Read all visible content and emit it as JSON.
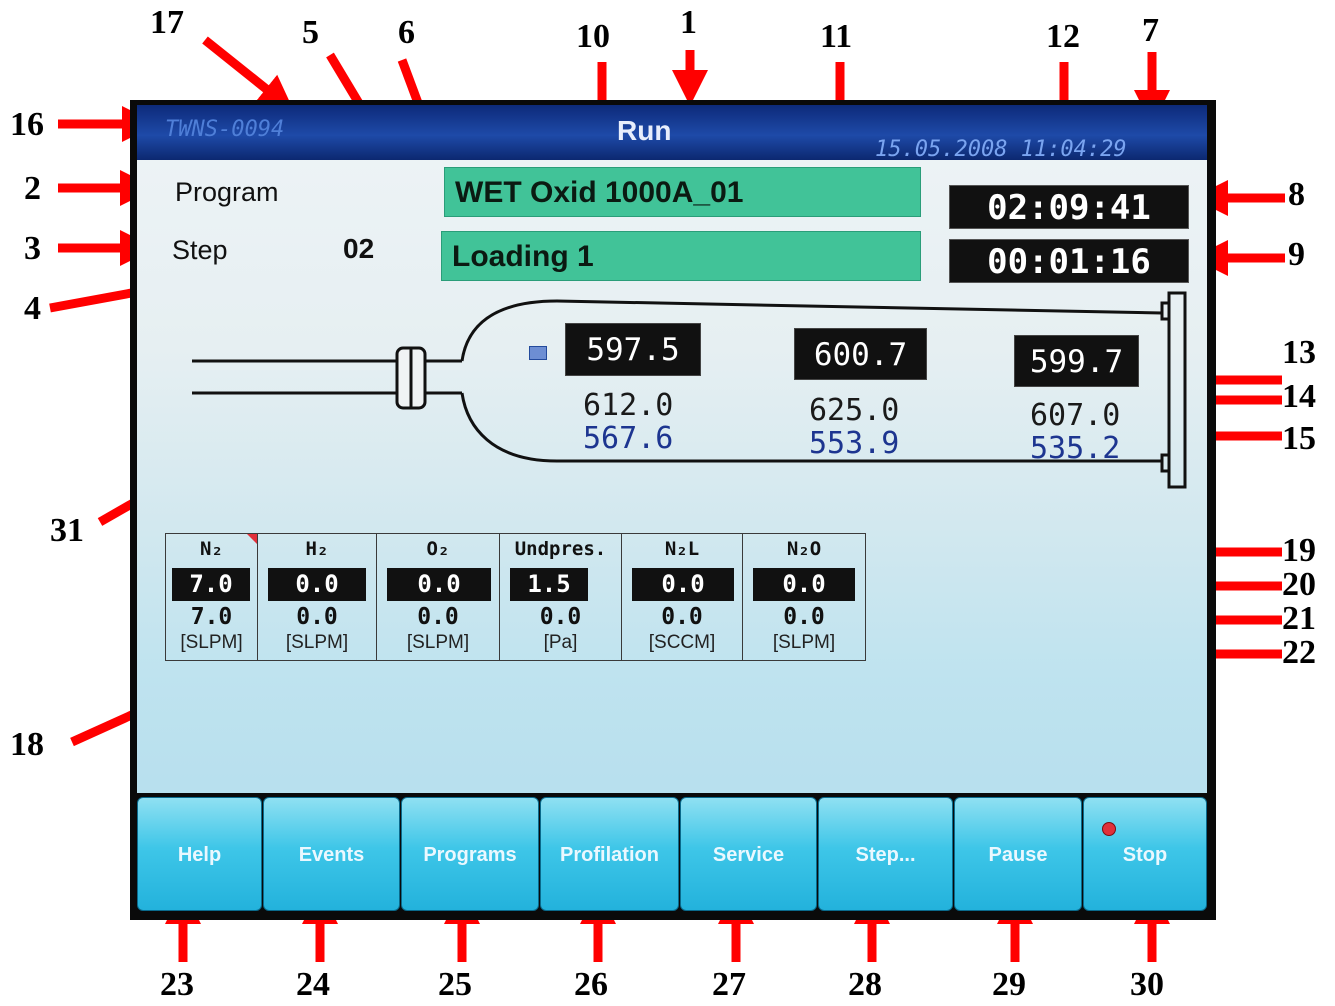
{
  "titlebar": {
    "system_id": "TWNS-0094",
    "title": "Run",
    "datetime": "15.05.2008 11:04:29"
  },
  "program": {
    "label": "Program",
    "name": "WET Oxid 1000A_01"
  },
  "step": {
    "label": "Step",
    "number": "02",
    "name": "Loading 1"
  },
  "timers": {
    "total": "02:09:41",
    "step": "00:01:16"
  },
  "zones": [
    {
      "actual": "597.5",
      "setpoint": "612.0",
      "lower": "567.6"
    },
    {
      "actual": "600.7",
      "setpoint": "625.0",
      "lower": "553.9"
    },
    {
      "actual": "599.7",
      "setpoint": "607.0",
      "lower": "535.2"
    }
  ],
  "gases": [
    {
      "name": "N₂",
      "value": "7.0",
      "setpoint": "7.0",
      "unit": "[SLPM]"
    },
    {
      "name": "H₂",
      "value": "0.0",
      "setpoint": "0.0",
      "unit": "[SLPM]"
    },
    {
      "name": "O₂",
      "value": "0.0",
      "setpoint": "0.0",
      "unit": "[SLPM]"
    },
    {
      "name": "Undpres.",
      "value": "1.5",
      "setpoint": "0.0",
      "unit": "[Pa]"
    },
    {
      "name": "N₂L",
      "value": "0.0",
      "setpoint": "0.0",
      "unit": "[SCCM]"
    },
    {
      "name": "N₂O",
      "value": "0.0",
      "setpoint": "0.0",
      "unit": "[SLPM]"
    }
  ],
  "buttons": [
    "Help",
    "Events",
    "Programs",
    "Profilation",
    "Service",
    "Step...",
    "Pause",
    "Stop"
  ],
  "callouts": [
    "1",
    "2",
    "3",
    "4",
    "5",
    "6",
    "7",
    "8",
    "9",
    "10",
    "11",
    "12",
    "13",
    "14",
    "15",
    "16",
    "17",
    "18",
    "19",
    "20",
    "21",
    "22",
    "23",
    "24",
    "25",
    "26",
    "27",
    "28",
    "29",
    "30",
    "31"
  ],
  "colors": {
    "title_bar": "#1e4aa8",
    "program_box": "#41c398",
    "button": "#3ec6e8",
    "arrow": "#ff0000",
    "indicator": "#e0303a"
  }
}
